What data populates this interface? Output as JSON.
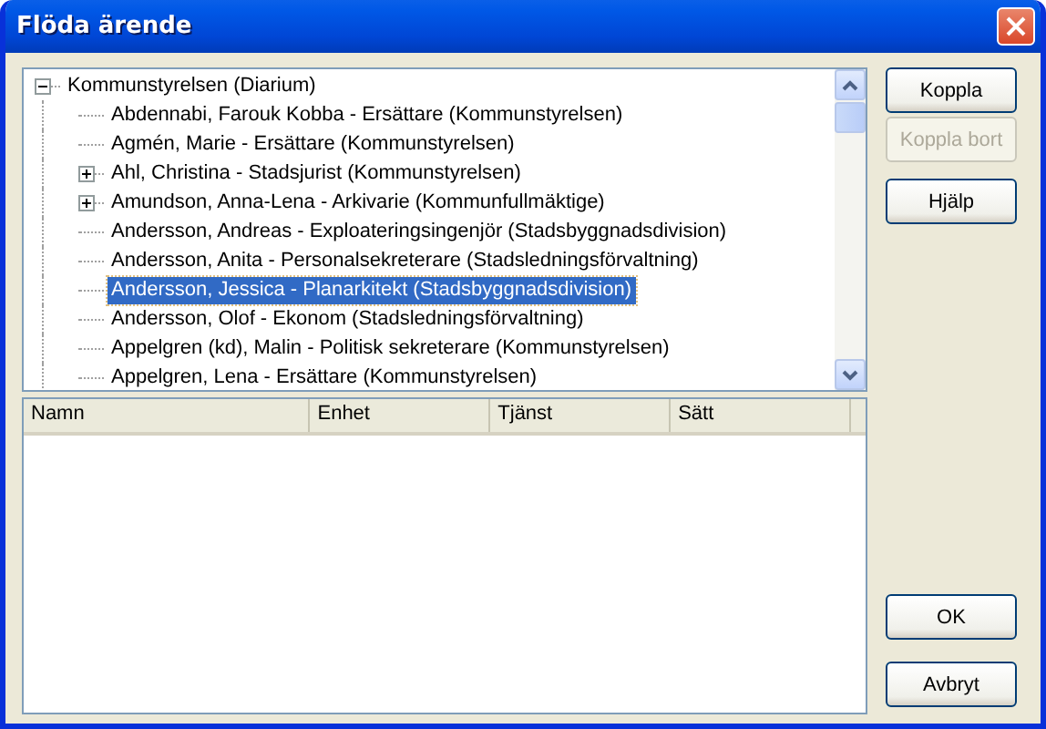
{
  "window": {
    "title": "Flöda ärende"
  },
  "tree": {
    "items": [
      {
        "label": "Kommunstyrelsen (Diarium)",
        "expanded": true,
        "selected": false,
        "children": [
          {
            "label": "Abdennabi, Farouk Kobba - Ersättare (Kommunstyrelsen)",
            "selected": false
          },
          {
            "label": "Agmén, Marie - Ersättare (Kommunstyrelsen)",
            "selected": false
          },
          {
            "label": "Ahl, Christina - Stadsjurist (Kommunstyrelsen)",
            "expanded": false,
            "selected": false
          },
          {
            "label": "Amundson, Anna-Lena - Arkivarie (Kommunfullmäktige)",
            "expanded": false,
            "selected": false
          },
          {
            "label": "Andersson, Andreas - Exploateringsingenjör (Stadsbyggnadsdivision)",
            "selected": false
          },
          {
            "label": "Andersson, Anita - Personalsekreterare (Stadsledningsförvaltning)",
            "selected": false
          },
          {
            "label": "Andersson, Jessica - Planarkitekt (Stadsbyggnadsdivision)",
            "selected": true
          },
          {
            "label": "Andersson, Olof - Ekonom (Stadsledningsförvaltning)",
            "selected": false
          },
          {
            "label": "Appelgren (kd), Malin - Politisk sekreterare (Kommunstyrelsen)",
            "selected": false
          },
          {
            "label": "Appelgren, Lena - Ersättare (Kommunstyrelsen)",
            "selected": false
          }
        ]
      }
    ]
  },
  "list": {
    "columns": [
      "Namn",
      "Enhet",
      "Tjänst",
      "Sätt"
    ]
  },
  "buttons": [
    {
      "label": "Koppla",
      "disabled": false,
      "kind": "top"
    },
    {
      "label": "Koppla bort",
      "disabled": true,
      "kind": "top"
    },
    {
      "label": "Hjälp",
      "disabled": false,
      "kind": "top"
    },
    {
      "label": "OK",
      "disabled": false,
      "kind": "bottom"
    },
    {
      "label": "Avbryt",
      "disabled": false,
      "kind": "bottom"
    }
  ]
}
